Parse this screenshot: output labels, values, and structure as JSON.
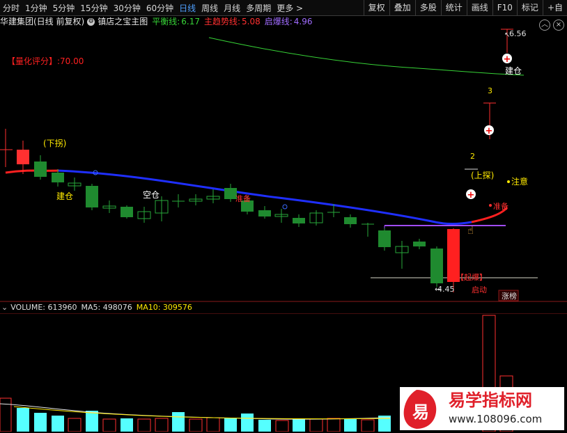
{
  "toolbar": {
    "tabs": [
      "分时",
      "1分钟",
      "5分钟",
      "15分钟",
      "30分钟",
      "60分钟",
      "日线",
      "周线",
      "月线",
      "多周期",
      "更多 >"
    ],
    "active_tab": "日线",
    "right_buttons": [
      "复权",
      "叠加",
      "多股",
      "统计",
      "画线",
      "F10",
      "标记",
      "+自"
    ]
  },
  "header": {
    "stock": "华建集团(日线 前复权)",
    "indicator": "镇店之宝主图",
    "legend": [
      {
        "label": "平衡线:",
        "value": "6.17",
        "color": "#37d437"
      },
      {
        "label": "主趋势线:",
        "value": "5.08",
        "color": "#ff3030"
      },
      {
        "label": "启爆线:",
        "value": "4.96",
        "color": "#a06cff"
      }
    ]
  },
  "chart": {
    "score_label": "【量化评分】",
    "score_value": ":70.00",
    "annotations": {
      "down_pull": "(下拐)",
      "build_left": "建仓",
      "empty": "空仓",
      "prepare1": "准备",
      "marker3": "3",
      "marker2": "2",
      "up_probe": "(上探)",
      "notice": "注意",
      "prepare2": "准备",
      "build_right": "建仓",
      "explode": "【起爆】",
      "launch": "启动",
      "limit_up": "涨榜"
    },
    "price_high": "6.56",
    "price_low": "4.45",
    "colors": {
      "up": "#ff3030",
      "down": "#1f8a2f",
      "balance": "#37d437",
      "trend": "#1f2fff",
      "explode": "#a04cff"
    }
  },
  "volume": {
    "label": "VOLUME: 613960",
    "ma5": "MA5: 498076",
    "ma10": "MA10: 309576"
  },
  "watermark": {
    "logo": "易",
    "brand": "易学指标网",
    "url": "www.108096.com"
  }
}
